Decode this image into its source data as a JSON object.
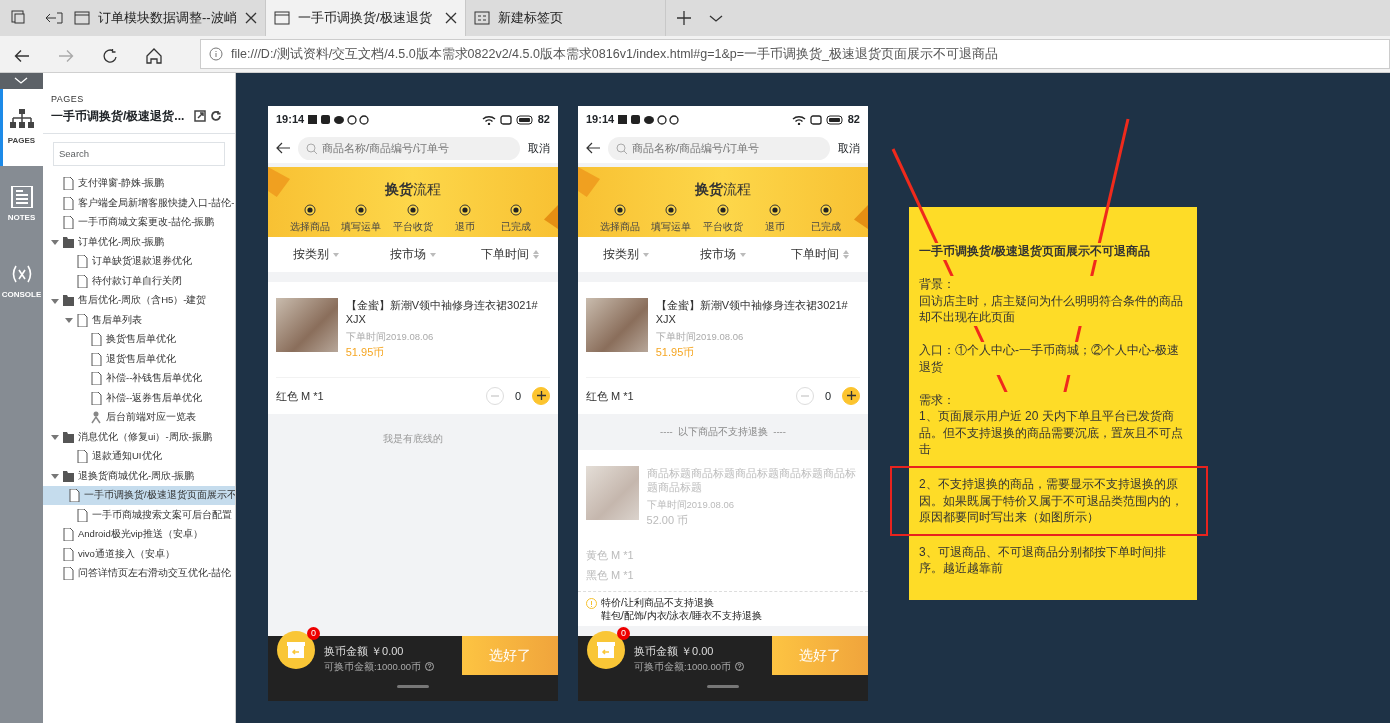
{
  "browser": {
    "tabs": [
      {
        "title": "订单模块数据调整--波峭",
        "selected": false
      },
      {
        "title": "一手币调换货/极速退货",
        "selected": true
      },
      {
        "title": "新建标签页",
        "selected": false
      }
    ],
    "url": "file:///D:/测试资料/交互文档/4.5.0版本需求0822v2/4.5.0版本需求0816v1/index.html#g=1&p=一手币调换货_极速退货页面展示不可退商品"
  },
  "rail": [
    {
      "label": "PAGES",
      "kind": "pages",
      "selected": true
    },
    {
      "label": "NOTES",
      "kind": "notes",
      "selected": false
    },
    {
      "label": "CONSOLE",
      "kind": "console",
      "selected": false
    }
  ],
  "pages_panel": {
    "heading": "PAGES",
    "title": "一手币调换货/极速退货...",
    "search_placeholder": "Search",
    "tree": [
      {
        "label": "支付弹窗-静姝-振鹏",
        "kind": "page",
        "selected": false
      },
      {
        "label": "客户端全局新增客服快捷入口-喆伦-",
        "kind": "page",
        "selected": false
      },
      {
        "label": "一手币商城文案更改-喆伦-振鹏",
        "kind": "page",
        "selected": false
      },
      {
        "label": "订单优化-周欣-振鹏",
        "kind": "folder",
        "selected": false,
        "expanded": true,
        "children": [
          {
            "label": "订单缺货退款退券优化",
            "kind": "page",
            "selected": false
          },
          {
            "label": "待付款订单自行关闭",
            "kind": "page",
            "selected": false
          }
        ]
      },
      {
        "label": "售后优化-周欣（含H5）-建贺",
        "kind": "folder",
        "selected": false,
        "expanded": true,
        "children": [
          {
            "label": "售后单列表",
            "kind": "page",
            "selected": false,
            "expanded": true,
            "children": [
              {
                "label": "换货售后单优化",
                "kind": "page",
                "selected": false
              },
              {
                "label": "退货售后单优化",
                "kind": "page",
                "selected": false
              },
              {
                "label": "补偿--补钱售后单优化",
                "kind": "page",
                "selected": false
              },
              {
                "label": "补偿--返券售后单优化",
                "kind": "page",
                "selected": false
              },
              {
                "label": "后台前端对应一览表",
                "kind": "flow",
                "selected": false
              }
            ]
          }
        ]
      },
      {
        "label": "消息优化（修复ui）-周欣-振鹏",
        "kind": "folder",
        "selected": false,
        "expanded": true,
        "children": [
          {
            "label": "退款通知UI优化",
            "kind": "page",
            "selected": false
          }
        ]
      },
      {
        "label": "退换货商城优化-周欣-振鹏",
        "kind": "folder",
        "selected": false,
        "expanded": true,
        "children": [
          {
            "label": "一手币调换货/极速退货页面展示不",
            "kind": "page",
            "selected": true
          },
          {
            "label": "一手币商城搜索文案可后台配置",
            "kind": "page",
            "selected": false
          }
        ]
      },
      {
        "label": "Android极光vip推送（安卓）",
        "kind": "page",
        "selected": false
      },
      {
        "label": "vivo通道接入（安卓）",
        "kind": "page",
        "selected": false
      },
      {
        "label": "问答详情页左右滑动交互优化-喆伦",
        "kind": "page",
        "selected": false
      }
    ]
  },
  "phones": [
    {
      "time": "19:14",
      "battery": "82",
      "search_placeholder": "商品名称/商品编号/订单号",
      "cancel": "取消",
      "banner_title": "**换货**流程",
      "steps": [
        "选择商品",
        "填写运单",
        "平台收货",
        "退币",
        "已完成"
      ],
      "filters": [
        {
          "label": "按类别",
          "kind": "dropdown"
        },
        {
          "label": "按市场",
          "kind": "dropdown"
        },
        {
          "label": "下单时间",
          "kind": "sort"
        }
      ],
      "sections": [
        {
          "kind": "product",
          "disabled": false,
          "title": "【金蜜】新潮V领中袖修身连衣裙3021# XJX",
          "date": "下单时间2019.08.06",
          "price": "51.95币",
          "skus": [
            {
              "label": "红色 M *1",
              "count": "0"
            }
          ]
        },
        {
          "kind": "end",
          "text": "我是有底线的"
        }
      ],
      "cart": {
        "badge": "0",
        "amount": "换币金额 ￥0.00",
        "available": "可换币金额:1000.00币",
        "button": "选好了"
      }
    },
    {
      "time": "19:14",
      "battery": "82",
      "search_placeholder": "商品名称/商品编号/订单号",
      "cancel": "取消",
      "banner_title": "**换货**流程",
      "steps": [
        "选择商品",
        "填写运单",
        "平台收货",
        "退币",
        "已完成"
      ],
      "filters": [
        {
          "label": "按类别",
          "kind": "dropdown"
        },
        {
          "label": "按市场",
          "kind": "dropdown"
        },
        {
          "label": "下单时间",
          "kind": "sort"
        }
      ],
      "sections": [
        {
          "kind": "product",
          "disabled": false,
          "title": "【金蜜】新潮V领中袖修身连衣裙3021# XJX",
          "date": "下单时间2019.08.06",
          "price": "51.95币",
          "skus": [
            {
              "label": "红色 M *1",
              "count": "0"
            }
          ]
        },
        {
          "kind": "divider",
          "text": "----  以下商品不支持退换  ----"
        },
        {
          "kind": "product",
          "disabled": true,
          "title": "商品标题商品标题商品标题商品标题商品标题商品标题",
          "date": "下单时间2019.08.06",
          "price": "52.00 币",
          "skus": [
            {
              "label": "黄色 M *1"
            },
            {
              "label": "黑色 M *1"
            }
          ]
        },
        {
          "kind": "notice",
          "lines": [
            "特价/让利商品不支持退换",
            "鞋包/配饰/内衣/泳衣/睡衣不支持退换"
          ]
        }
      ],
      "cart": {
        "badge": "0",
        "amount": "换币金额 ￥0.00",
        "available": "可换币金额:1000.00币",
        "button": "选好了"
      }
    }
  ],
  "note": {
    "title": "一手币调换货/极速退货页面展示不可退商品",
    "paragraphs": [
      {
        "lines": [
          "背景：",
          "回访店主时，店主疑问为什么明明符合条件的商品却不出现在此页面"
        ],
        "highlighted": false
      },
      {
        "lines": [
          "入口：①个人中心-一手币商城；②个人中心-极速退货"
        ],
        "highlighted": false
      },
      {
        "lines": [
          "需求：",
          "1、页面展示用户近 20 天内下单且平台已发货商品。但不支持退换的商品需要沉底，置灰且不可点击"
        ],
        "highlighted": false
      },
      {
        "lines": [
          "2、不支持退换的商品，需要显示不支持退换的原因。如果既属于特价又属于不可退品类范围内的，原因都要同时写出来（如图所示）"
        ],
        "highlighted": true
      },
      {
        "lines": [
          "3、可退商品、不可退商品分别都按下单时间排序。越近越靠前"
        ],
        "highlighted": false
      }
    ]
  }
}
